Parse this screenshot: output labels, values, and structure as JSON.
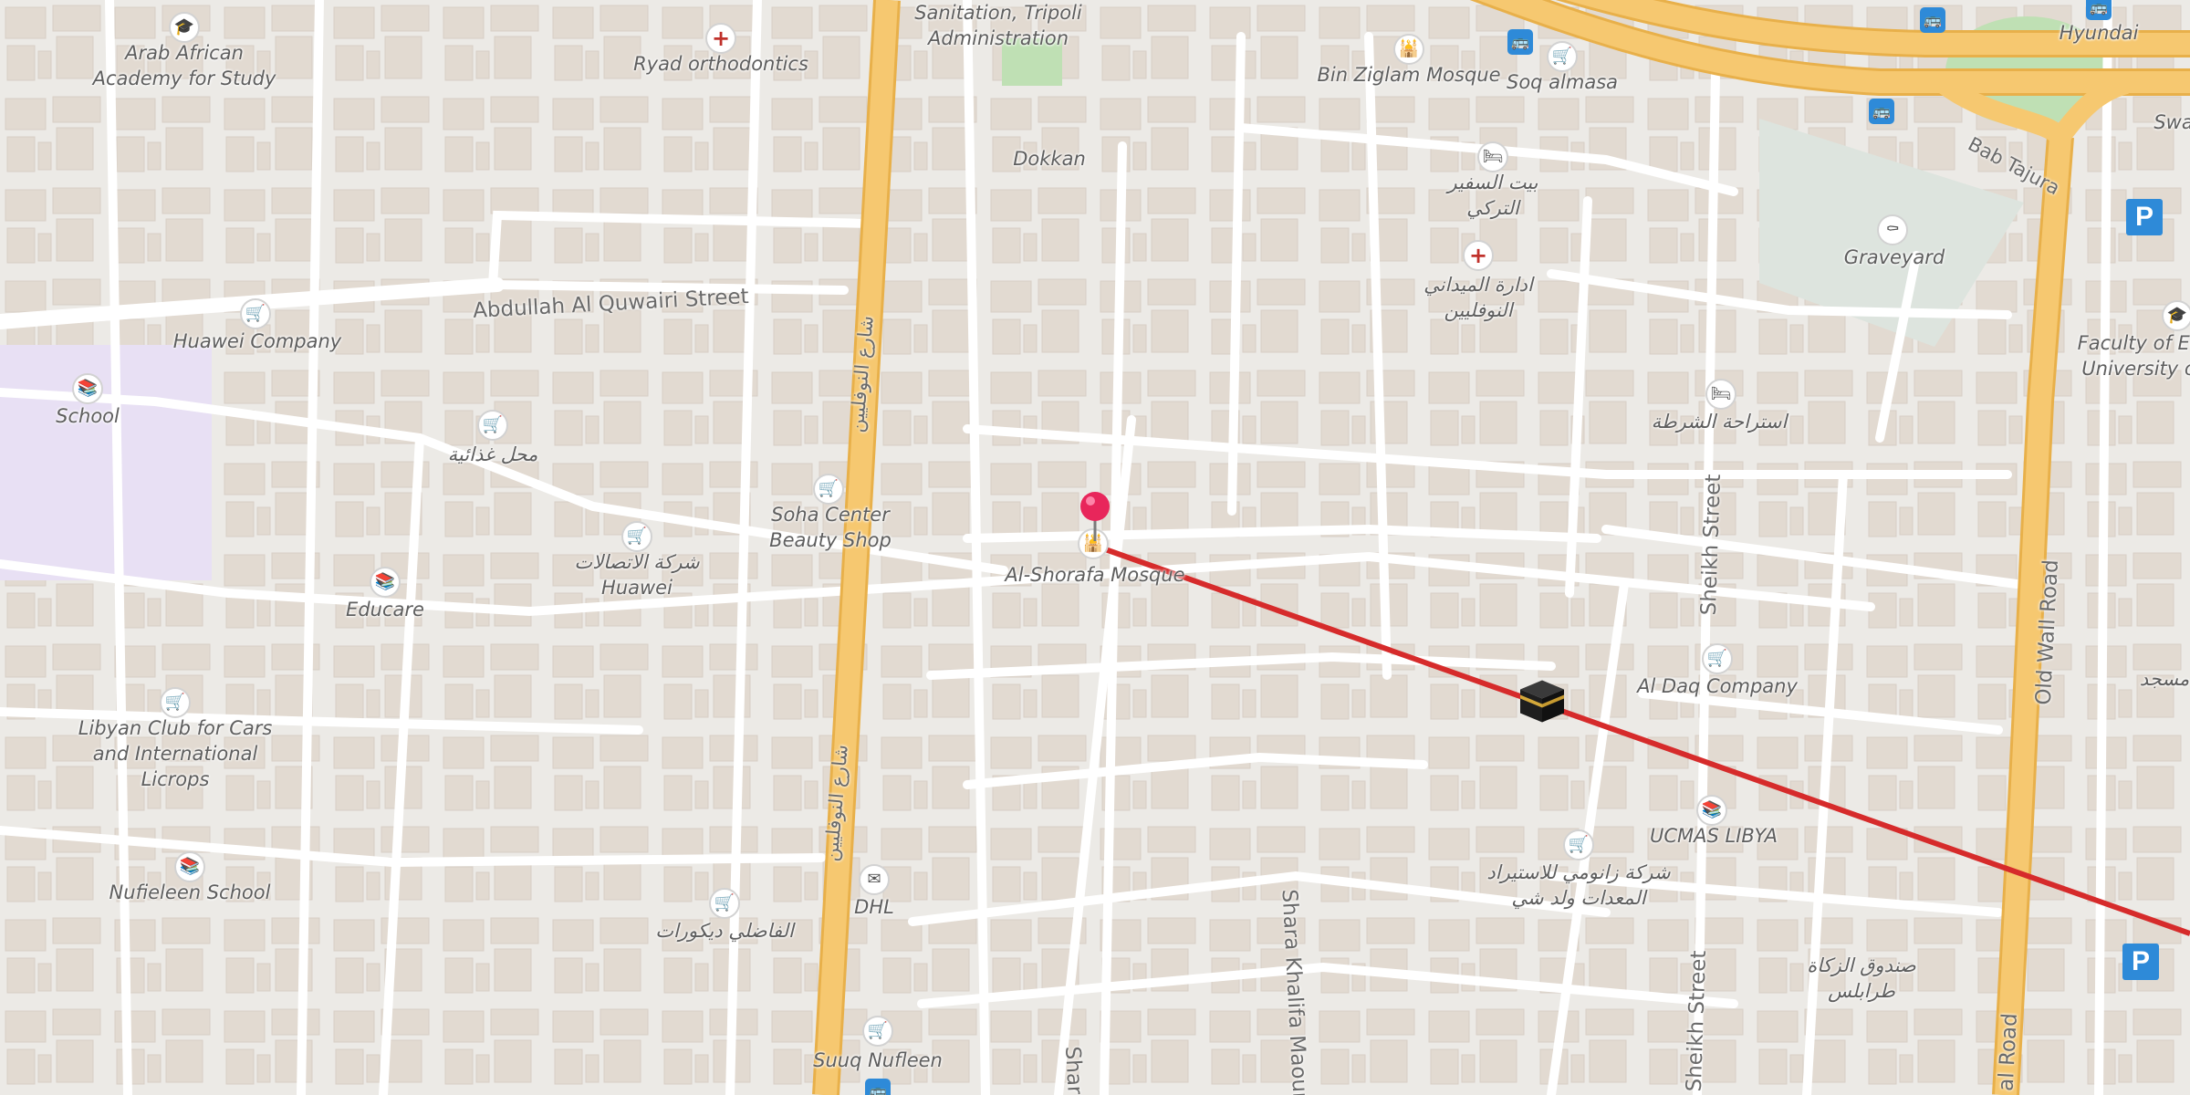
{
  "map": {
    "labels": {
      "arab_african_academy": "Arab African\nAcademy for Study",
      "ryad_orthodontics": "Ryad orthodontics",
      "sanitation": "Sanitation, Tripoli\nAdministration",
      "bin_ziglam_mosque": "Bin Ziglam Mosque",
      "soq_almasa": "Soq almasa",
      "hyundai": "Hyundai",
      "swa": "Swa",
      "bab_tajura": "Bab Tajura",
      "dokkan": "Dokkan",
      "turkish_ambassador": "بيت السفير\nالتركي",
      "graveyard": "Graveyard",
      "nofliyin_field": "ادارة الميداني\nالنوفليين",
      "faculty": "Faculty of Ec\nUniversity o",
      "huawei_company": "Huawei Company",
      "school": "School",
      "groceries": "محل غذائية",
      "police_rest": "استراحة الشرطة",
      "soha_center": "Soha Center\nBeauty Shop",
      "huawei_telecom": "شركة الاتصالات\nHuawei",
      "al_shorafa_mosque": "Al-Shorafa Mosque",
      "educare": "Educare",
      "al_daq_company": "Al Daq Company",
      "masjid_partial": "مسجد",
      "libyan_club": "Libyan Club for Cars\nand International\nLicrops",
      "ucmas_libya": "UCMAS LIBYA",
      "zanoumi_company": "شركة زانومي للاستيراد\nالمعدات ولد شي",
      "nufieleen_school": "Nufieleen School",
      "dhl": "DHL",
      "alfadhli_decor": "الفاضلي ديكورات",
      "zakat_fund": "صندوق الزكاة\nطرابلس",
      "suuq_nufleen": "Suuq Nufleen"
    },
    "streets": {
      "abdullah_quwairi": "Abdullah Al Quwairi Street",
      "nofliyin_upper": "شارع النوفليين",
      "nofliyin_lower": "شارع النوفليين",
      "sheikh_street_upper": "Sheikh Street",
      "sheikh_street_lower": "Sheikh Street",
      "old_wall_road_upper": "Old Wall Road",
      "old_wall_road_lower": "al Road",
      "shara_khalifa": "Shara Khalifa Maoun",
      "shara_partial": "Shar"
    },
    "parking_label": "P",
    "icons": {
      "shop": "shopping-cart-icon",
      "med": "medical-cross-icon",
      "mosque": "mosque-icon",
      "school": "school-icon",
      "edu": "graduation-cap-icon",
      "hotel": "bed-icon",
      "grave": "grave-icon",
      "mail": "envelope-icon",
      "bus": "bus-icon",
      "qibla": "kaaba-icon",
      "pin": "location-pin-icon"
    },
    "colors": {
      "background": "#eceae6",
      "building": "#e1d9d0",
      "road": "#ffffff",
      "highway": "#f6c870",
      "qibla_line": "#d62b2b",
      "pin": "#e8265b",
      "school_area": "#e8e0f4",
      "park": "#bfe0b4",
      "cemetery": "#dde4de"
    }
  }
}
